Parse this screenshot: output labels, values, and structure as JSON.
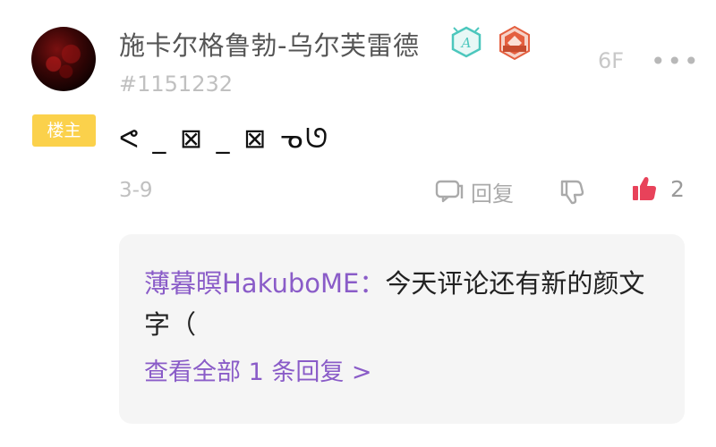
{
  "post": {
    "username": "施卡尔格鲁勃-乌尔芙雷德",
    "uid": "#1151232",
    "floor": "6F",
    "more_label": "•••",
    "owner_tag": "楼主",
    "content": "ᕙ _ ⊠ _ ⊠ ᓀᘎ",
    "date": "3-9",
    "reply_label": "回复",
    "like_count": "2"
  },
  "icons": {
    "badge_1": "level-badge-icon",
    "badge_2": "fan-medal-icon",
    "reply": "comment-bubble-icon",
    "dislike": "thumbs-down-icon",
    "like": "thumbs-up-icon"
  },
  "colors": {
    "owner_tag": "#fbd14b",
    "accent_purple": "#8a5cc8",
    "like_red": "#e8425a",
    "badge_teal": "#4cc7bd",
    "badge_orange": "#e45f3f"
  },
  "replies": {
    "author": "薄暮暝HakuboME",
    "separator": "：",
    "text": "今天评论还有新的颜文字（",
    "view_all": "查看全部 1 条回复 >"
  }
}
